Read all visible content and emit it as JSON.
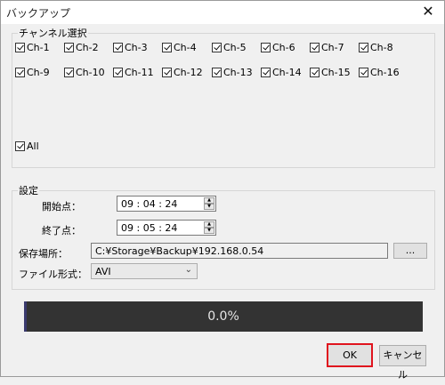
{
  "window": {
    "title": "バックアップ",
    "close_glyph": "✕"
  },
  "channel_group": {
    "legend": "チャンネル選択",
    "channels": [
      "Ch-1",
      "Ch-2",
      "Ch-3",
      "Ch-4",
      "Ch-5",
      "Ch-6",
      "Ch-7",
      "Ch-8",
      "Ch-9",
      "Ch-10",
      "Ch-11",
      "Ch-12",
      "Ch-13",
      "Ch-14",
      "Ch-15",
      "Ch-16"
    ],
    "all_label": "All"
  },
  "settings_group": {
    "legend": "設定",
    "start_label": "開始点：",
    "start_value": "09 : 04 : 24",
    "end_label": "終了点：",
    "end_value": "09 : 05 : 24",
    "save_label": "保存場所：",
    "save_path": "C:¥Storage¥Backup¥192.168.0.54",
    "browse_label": "...",
    "format_label": "ファイル形式：",
    "format_value": "AVI"
  },
  "progress": {
    "text": "0.0%",
    "value": 0.0
  },
  "buttons": {
    "ok": "OK",
    "cancel": "キャンセル"
  },
  "colors": {
    "ok_highlight": "#e0141e",
    "progress_bg": "#333333"
  }
}
